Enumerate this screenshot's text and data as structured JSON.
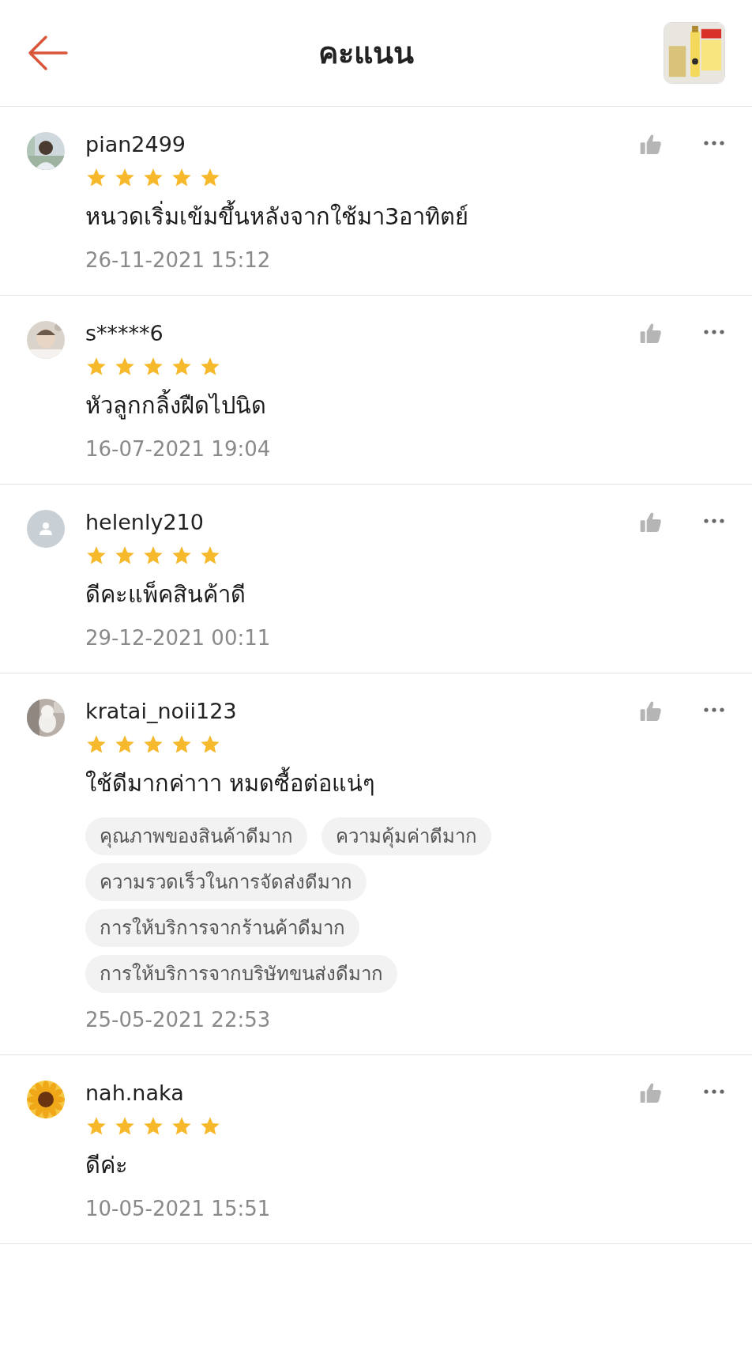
{
  "header": {
    "title": "คะแนน"
  },
  "reviews": [
    {
      "username": "pian2499",
      "stars": 5,
      "comment": "หนวดเริ่มเข้มขึ้นหลังจากใช้มา3อาทิตย์",
      "date": "26-11-2021 15:12"
    },
    {
      "username": "s*****6",
      "stars": 5,
      "comment": "หัวลูกกลิ้งฝืดไปนิด",
      "date": "16-07-2021 19:04"
    },
    {
      "username": "helenly210",
      "avatar": {
        "kind": "default"
      },
      "stars": 5,
      "comment": "ดีคะแพ็คสินค้าดี",
      "date": "29-12-2021 00:11"
    },
    {
      "username": "kratai_noii123",
      "stars": 5,
      "comment": "ใช้ดีมากค่าาา หมดซื้อต่อแน่ๆ",
      "tags": [
        "คุณภาพของสินค้าดีมาก",
        "ความคุ้มค่าดีมาก",
        "ความรวดเร็วในการจัดส่งดีมาก",
        "การให้บริการจากร้านค้าดีมาก",
        "การให้บริการจากบริษัทขนส่งดีมาก"
      ],
      "date": "25-05-2021 22:53"
    },
    {
      "username": "nah.naka",
      "stars": 5,
      "comment": "ดีค่ะ",
      "date": "10-05-2021 15:51"
    }
  ]
}
